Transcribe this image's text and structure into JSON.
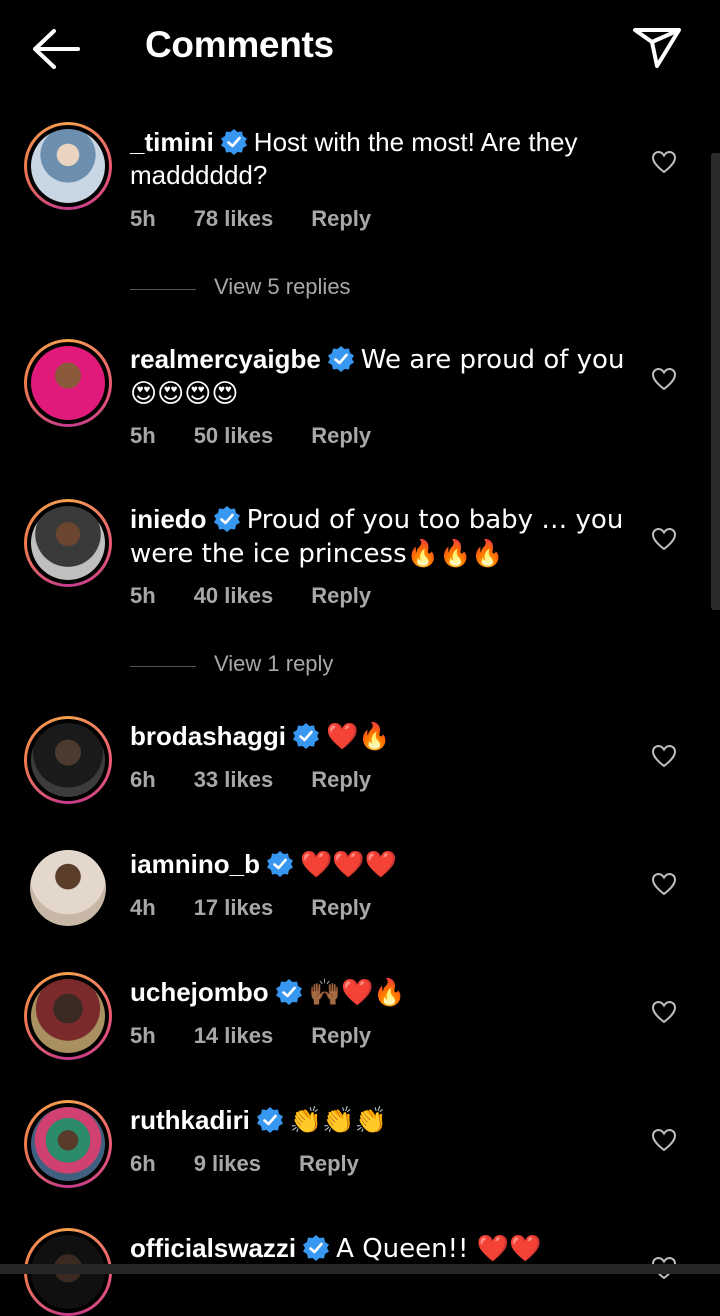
{
  "header": {
    "title": "Comments"
  },
  "comments": [
    {
      "username": "_timini",
      "text": "Host with the most! Are they madddddd?",
      "time": "5h",
      "likes": "78 likes",
      "reply": "Reply"
    },
    {
      "username": "realmercyaigbe",
      "text": "We are proud of you 😍😍😍😍",
      "time": "5h",
      "likes": "50 likes",
      "reply": "Reply"
    },
    {
      "username": "iniedo",
      "text": "Proud of you too baby … you were the ice princess🔥🔥🔥",
      "time": "5h",
      "likes": "40 likes",
      "reply": "Reply"
    },
    {
      "username": "brodashaggi",
      "text": "❤️🔥",
      "time": "6h",
      "likes": "33 likes",
      "reply": "Reply"
    },
    {
      "username": "iamnino_b",
      "text": "❤️❤️❤️",
      "time": "4h",
      "likes": "17 likes",
      "reply": "Reply"
    },
    {
      "username": "uchejombo",
      "text": "🙌🏾❤️🔥",
      "time": "5h",
      "likes": "14 likes",
      "reply": "Reply"
    },
    {
      "username": "ruthkadiri",
      "text": "👏👏👏",
      "time": "6h",
      "likes": "9 likes",
      "reply": "Reply"
    },
    {
      "username": "officialswazzi",
      "text": "A Queen!! ❤️❤️",
      "time": "",
      "likes": "",
      "reply": ""
    }
  ],
  "view_replies": [
    {
      "label": "View 5 replies"
    },
    {
      "label": "View 1 reply"
    }
  ],
  "colors": {
    "background": "#000000",
    "meta": "#a8a8a8",
    "verified": "#3897f0",
    "story_ring": "#e85a73"
  },
  "icons": [
    "back-arrow-icon",
    "send-icon",
    "verified-badge-icon",
    "heart-icon"
  ]
}
